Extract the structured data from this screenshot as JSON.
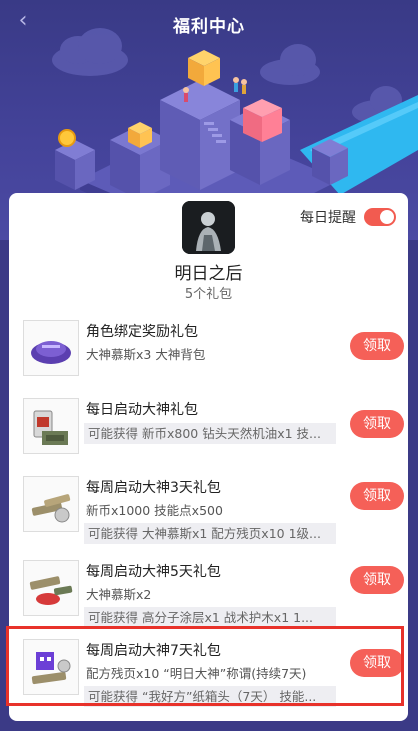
{
  "header": {
    "title": "福利中心",
    "back_icon": "chevron-left-icon"
  },
  "reminder": {
    "label": "每日提醒",
    "on": true,
    "color": "#f25b50"
  },
  "game": {
    "name": "明日之后",
    "pack_count": "5个礼包"
  },
  "claim_color": "#f56058",
  "packs": [
    {
      "name": "角色绑定奖励礼包",
      "desc": "大神慕斯x3 大神背包",
      "maybe": "",
      "button": "领取"
    },
    {
      "name": "每日启动大神礼包",
      "desc": "",
      "maybe": "可能获得 新币x800 钻头天然机油x1 技...",
      "button": "领取"
    },
    {
      "name": "每周启动大神3天礼包",
      "desc": "新币x1000 技能点x500",
      "maybe": "可能获得 大神慕斯x1 配方残页x10 1级...",
      "button": "领取"
    },
    {
      "name": "每周启动大神5天礼包",
      "desc": "大神慕斯x2",
      "maybe": "可能获得 高分子涂层x1 战术护木x1 1...",
      "button": "领取"
    },
    {
      "name": "每周启动大神7天礼包",
      "desc": "配方残页x10 “明日大神”称谓(持续7天)",
      "maybe": "可能获得 “我好方”纸箱头（7天） 技能...",
      "button": "领取"
    }
  ]
}
